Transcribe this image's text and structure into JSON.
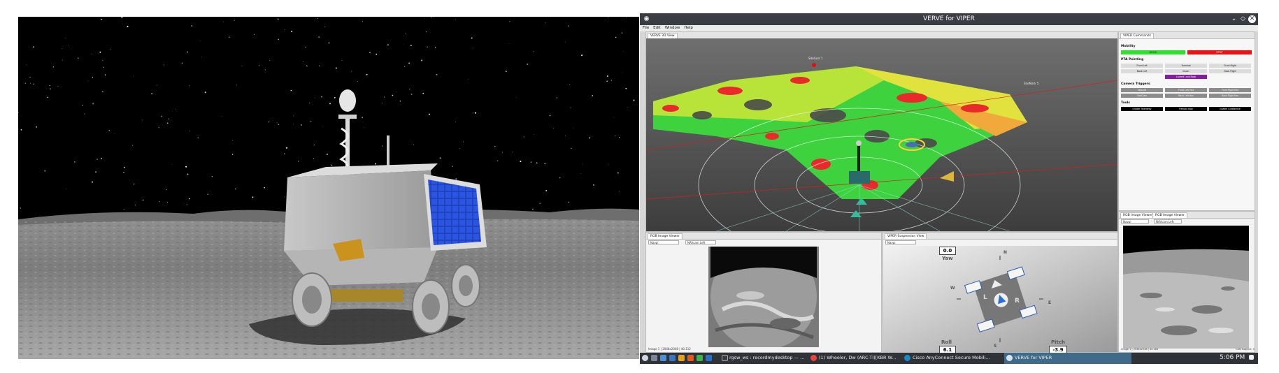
{
  "window": {
    "title": "VERVE for VIPER"
  },
  "menu": [
    "File",
    "Edit",
    "Window",
    "Help"
  ],
  "view3d": {
    "tab": "VERVE 3D View",
    "site_labels": [
      "SiteGoal 1",
      "SiteMark 5"
    ]
  },
  "commands": {
    "tab": "VIPER Commands",
    "mobility": {
      "heading": "Mobility",
      "go": "DRIVE",
      "stop": "STOP",
      "go_color": "#2de12d",
      "stop_color": "#ee1111"
    },
    "pointing": {
      "heading": "PTA Pointing",
      "buttons": [
        "Front Left",
        "Nominal",
        "Front Right",
        "Back Left",
        "Down",
        "Back Right"
      ],
      "special": "Locked Look Back",
      "special_color": "#8a1aa3"
    },
    "camera": {
      "heading": "Camera Triggers",
      "buttons": [
        "NavLeft",
        "Front Left Haz",
        "Front Right Haz",
        "NavCam",
        "Back Left Haz",
        "Back Right Haz"
      ]
    },
    "tools": {
      "heading": "Tools",
      "buttons": [
        "Enable Telemetry",
        "Rebuild Map",
        "Enable Confidence"
      ]
    }
  },
  "rgb_image_left": {
    "tab": "RGB Image Viewer",
    "select1": "Navpi",
    "select2": "NAVcam Left",
    "caption": "Image 1 | 2048x2048 | 40.112"
  },
  "suspension": {
    "tab": "VIPER Suspension View",
    "select": "Navpi",
    "yaw_label": "Yaw",
    "yaw": "0.0",
    "roll_label": "Roll",
    "roll": "6.1",
    "pitch_label": "Pitch",
    "pitch": "-3.9",
    "compass": [
      "N",
      "E",
      "S",
      "W"
    ],
    "body": {
      "left": "L",
      "right": "R"
    }
  },
  "rgb_image_right": {
    "tabs": [
      "RGB Image Viewer",
      "RGB Image Viewer"
    ],
    "select1": "Navpi",
    "select2": "NAVcam Left",
    "caption": "Image 1 | 2048x2048 | 40.184",
    "status": "CAN Support: 0"
  },
  "taskbar": {
    "items": [
      "rgsw_ws : recordmydesktop — ...",
      "(1) Wheeler, Dw (ARC-TI)[KBR W...",
      "Cisco AnyConnect Secure Mobili...",
      "VERVE for VIPER"
    ],
    "clock": "5:06 PM"
  }
}
